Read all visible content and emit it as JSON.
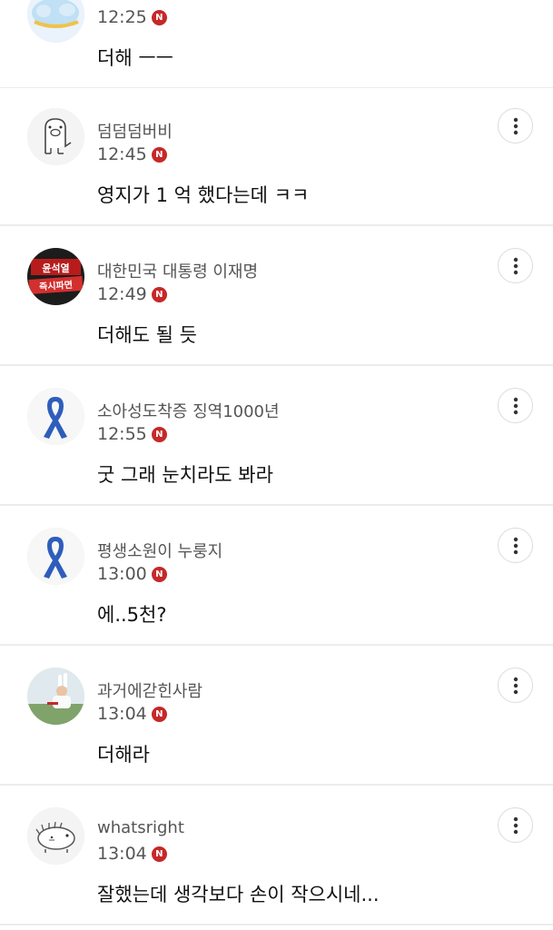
{
  "comments": [
    {
      "name": "",
      "time": "12:25",
      "text": "더해 ㅡㅡ",
      "badge": "N",
      "avatar": "cloud-animal"
    },
    {
      "name": "덤덤덤버비",
      "time": "12:45",
      "text": "영지가 1 억 했다는데 ㅋㅋ",
      "badge": "N",
      "avatar": "pig-sketch"
    },
    {
      "name": "대한민국 대통령 이재명",
      "time": "12:49",
      "text": "더해도 될 듯",
      "badge": "N",
      "avatar": "protest-sign",
      "avatar_text": [
        "윤석열",
        "즉시파면"
      ]
    },
    {
      "name": "소아성도착증 징역1000년",
      "time": "12:55",
      "text": "굿 그래 눈치라도 봐라",
      "badge": "N",
      "avatar": "blue-ribbon"
    },
    {
      "name": "평생소원이 누룽지",
      "time": "13:00",
      "text": "에..5천?",
      "badge": "N",
      "avatar": "blue-ribbon"
    },
    {
      "name": "과거에갇힌사람",
      "time": "13:04",
      "text": "더해라",
      "badge": "N",
      "avatar": "person-photo"
    },
    {
      "name": "whatsright",
      "time": "13:04",
      "text": "잘했는데 생각보다 손이 작으시네...",
      "badge": "N",
      "avatar": "hedgehog-sketch"
    }
  ]
}
